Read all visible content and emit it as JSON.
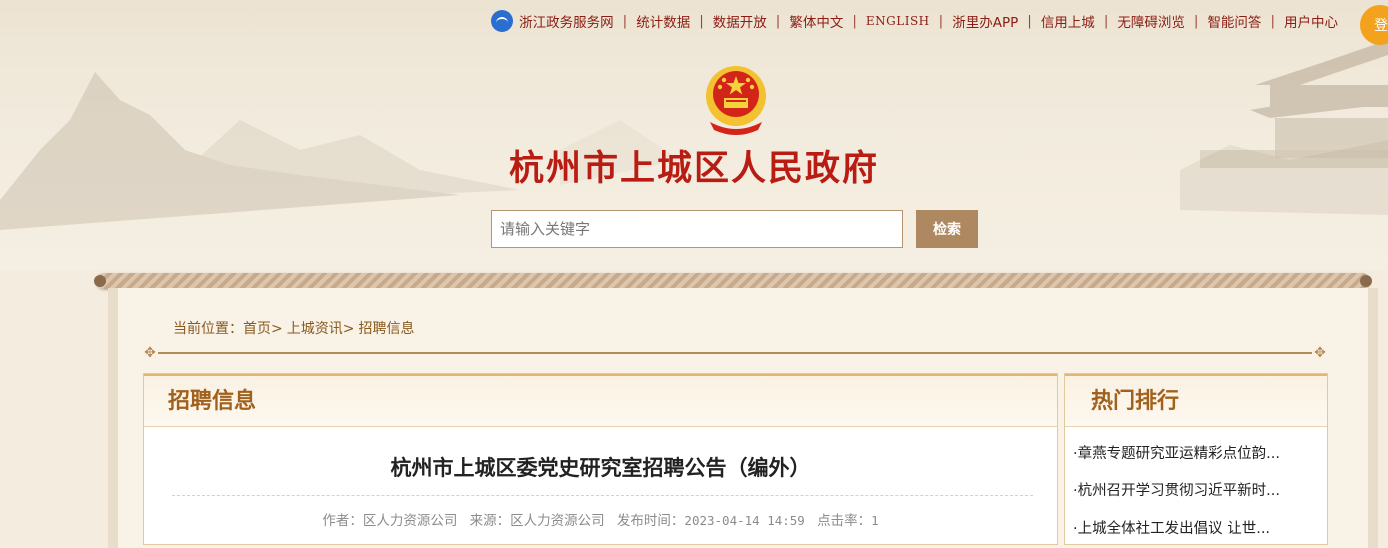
{
  "topbar": {
    "items": [
      {
        "label": "浙江政务服务网"
      },
      {
        "label": "统计数据"
      },
      {
        "label": "数据开放"
      },
      {
        "label": "繁体中文"
      },
      {
        "label": "ENGLISH"
      },
      {
        "label": "浙里办APP"
      },
      {
        "label": "信用上城"
      },
      {
        "label": "无障碍浏览"
      },
      {
        "label": "智能问答"
      },
      {
        "label": "用户中心"
      }
    ],
    "login_label": "登"
  },
  "header": {
    "site_title": "杭州市上城区人民政府"
  },
  "search": {
    "placeholder": "请输入关键字",
    "button_label": "检索"
  },
  "breadcrumb": {
    "prefix": "当前位置：",
    "items": [
      {
        "label": "首页"
      },
      {
        "label": "上城资讯"
      },
      {
        "label": "招聘信息"
      }
    ],
    "separator": ">"
  },
  "main": {
    "section_title": "招聘信息",
    "article": {
      "title": "杭州市上城区委党史研究室招聘公告（编外）",
      "author_label": "作者：",
      "author": "区人力资源公司",
      "source_label": "来源：",
      "source": "区人力资源公司",
      "date_label": "发布时间：",
      "date": "2023-04-14 14:59",
      "clicks_label": "点击率：",
      "clicks": "1"
    }
  },
  "sidebar": {
    "title": "热门排行",
    "items": [
      {
        "label": "·章燕专题研究亚运精彩点位韵..."
      },
      {
        "label": "·杭州召开学习贯彻习近平新时..."
      },
      {
        "label": "·上城全体社工发出倡议 让世..."
      }
    ]
  },
  "colors": {
    "brand_red": "#b81c13",
    "link_red": "#8b1d14",
    "accent_brown": "#ad8860",
    "heading_orange": "#a1611d"
  }
}
